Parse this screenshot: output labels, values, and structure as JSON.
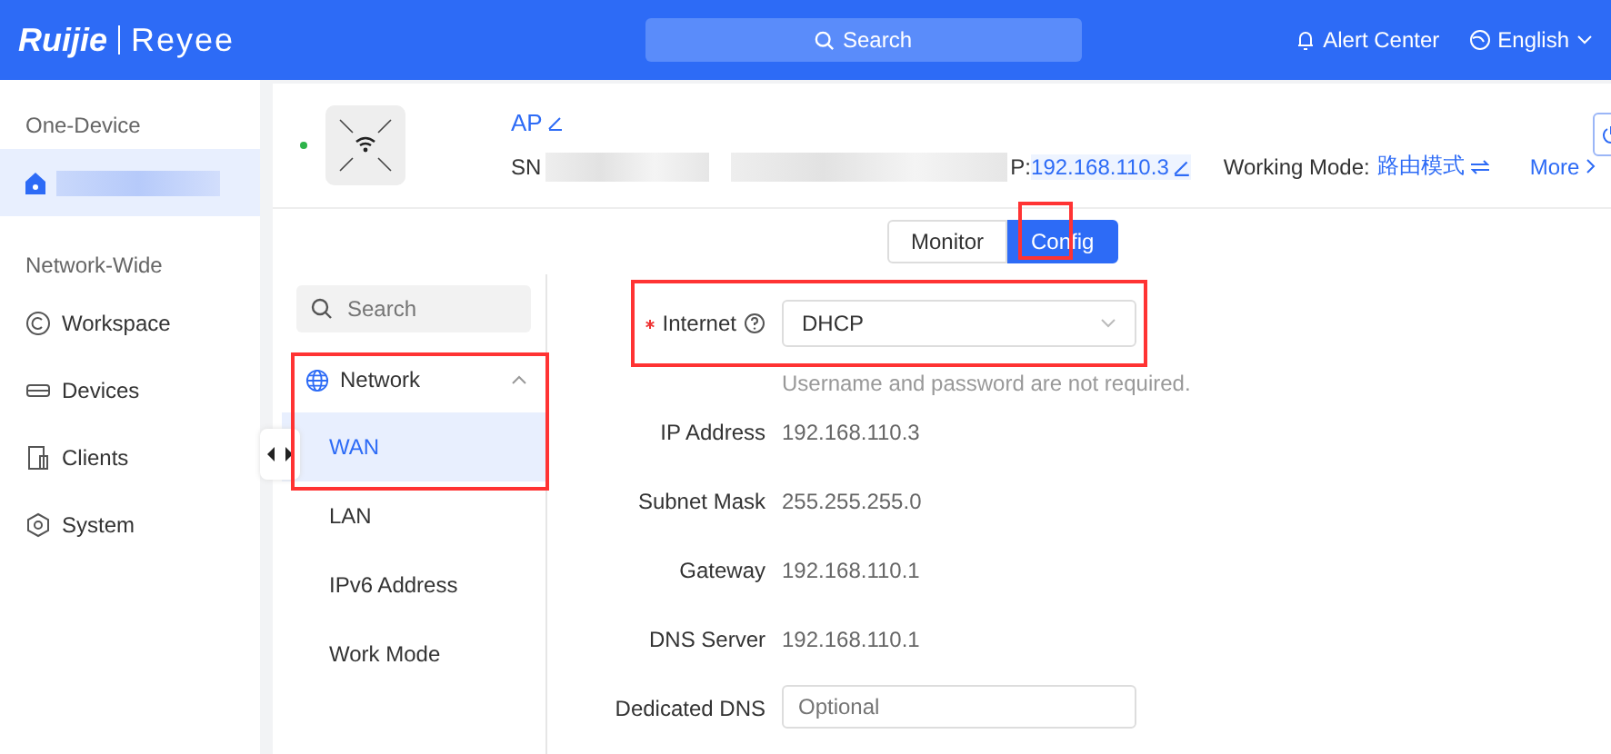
{
  "header": {
    "logo_brand": "Ruijie",
    "logo_product": "Reyee",
    "search": "Search",
    "alert": "Alert Center",
    "language": "English"
  },
  "sidebar": {
    "sections": [
      {
        "title": "One-Device",
        "items": [
          {
            "redacted": true,
            "selected": true
          }
        ]
      },
      {
        "title": "Network-Wide",
        "items": [
          {
            "label": "Workspace",
            "selected": false
          },
          {
            "label": "Devices",
            "selected": false
          },
          {
            "label": "Clients",
            "selected": false
          },
          {
            "label": "System",
            "selected": false
          }
        ]
      }
    ]
  },
  "device": {
    "online": true,
    "name": "AP",
    "sn_label": "SN",
    "ip_label": "P:",
    "ip": "192.168.110.3",
    "mode_label": "Working Mode:",
    "mode": "路由模式",
    "more": "More"
  },
  "tabs": [
    {
      "label": "Monitor",
      "selected": false
    },
    {
      "label": "Config",
      "selected": true
    }
  ],
  "menu": {
    "search": {
      "placeholder": "Search"
    },
    "groups": [
      {
        "label": "Network",
        "expanded": true,
        "children": [
          {
            "label": "WAN",
            "selected": true
          },
          {
            "label": "LAN",
            "selected": false
          },
          {
            "label": "IPv6 Address",
            "selected": false
          },
          {
            "label": "Work Mode",
            "selected": false
          }
        ]
      }
    ]
  },
  "form": {
    "internet": {
      "label": "Internet",
      "required": true,
      "value": "DHCP",
      "hint": "Username and password are not required."
    },
    "rows": [
      {
        "label": "IP Address",
        "value": "192.168.110.3"
      },
      {
        "label": "Subnet Mask",
        "value": "255.255.255.0"
      },
      {
        "label": "Gateway",
        "value": "192.168.110.1"
      },
      {
        "label": "DNS Server",
        "value": "192.168.110.1"
      }
    ],
    "dedicated_dns": {
      "label": "Dedicated DNS",
      "placeholder": "Optional"
    }
  }
}
